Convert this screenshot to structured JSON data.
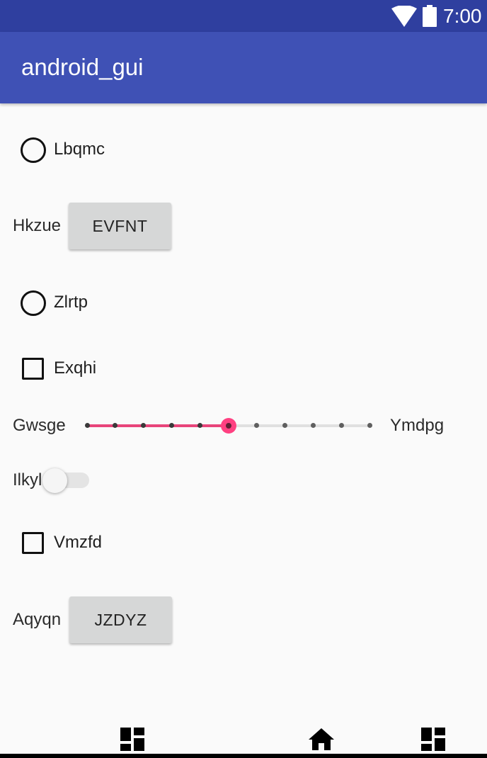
{
  "status_bar": {
    "time": "7:00",
    "wifi_icon": "wifi-icon",
    "battery_icon": "battery-icon",
    "background": "#2f3f9f"
  },
  "app_bar": {
    "title": "android_gui",
    "background": "#3f51b5"
  },
  "widgets": {
    "radio_1": {
      "label": "Lbqmc",
      "checked": false
    },
    "button_row_1": {
      "label": "Hkzue",
      "button": "EVFNT"
    },
    "radio_2": {
      "label": "Zlrtp",
      "checked": false
    },
    "checkbox_1": {
      "label": "Exqhi",
      "checked": false
    },
    "seekbar": {
      "start_label": "Gwsge",
      "end_label": "Ymdpg",
      "value": 5,
      "max": 10,
      "accent": "#ff4081"
    },
    "switch": {
      "label": "Ilkyl",
      "on": false
    },
    "checkbox_2": {
      "label": "Vmzfd",
      "checked": false
    },
    "button_row_2": {
      "label": "Aqyqn",
      "button": "JZDYZ"
    }
  },
  "nav_bar": {
    "left_icon": "dashboard-icon",
    "center_icon": "home-icon",
    "right_icon": "dashboard-icon"
  }
}
